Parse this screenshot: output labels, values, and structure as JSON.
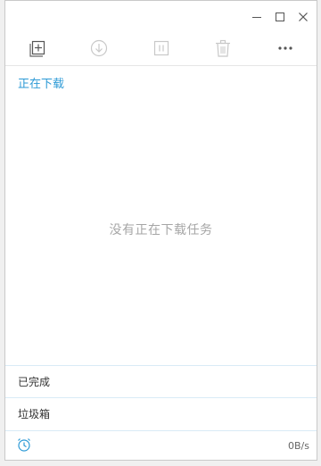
{
  "window": {
    "controls": [
      "minimize",
      "maximize",
      "close"
    ]
  },
  "toolbar": {
    "buttons": [
      "add-task-icon",
      "download-icon",
      "pause-icon",
      "trash-icon",
      "more-icon"
    ]
  },
  "downloading": {
    "section_title": "正在下载",
    "empty_message": "没有正在下载任务"
  },
  "categories": {
    "completed": "已完成",
    "trash": "垃圾箱"
  },
  "status": {
    "speed": "0B/s"
  },
  "colors": {
    "accent": "#2d9ad6",
    "icon_gray": "#999999",
    "divider": "#d9ebf6"
  }
}
